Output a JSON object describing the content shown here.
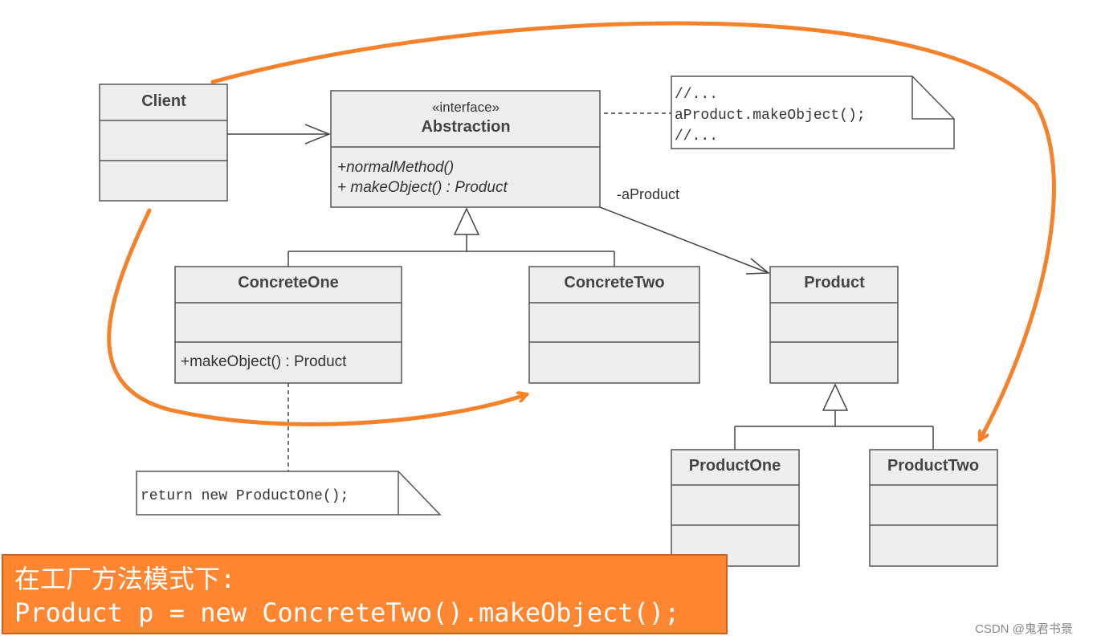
{
  "classes": {
    "client": {
      "name": "Client"
    },
    "abstraction": {
      "stereotype": "«interface»",
      "name": "Abstraction",
      "ops": [
        "+normalMethod()",
        "+ makeObject() : Product"
      ]
    },
    "concrete_one": {
      "name": "ConcreteOne",
      "ops": [
        "+makeObject() : Product"
      ]
    },
    "concrete_two": {
      "name": "ConcreteTwo"
    },
    "product": {
      "name": "Product"
    },
    "product_one": {
      "name": "ProductOne"
    },
    "product_two": {
      "name": "ProductTwo"
    }
  },
  "association_label": "-aProduct",
  "notes": {
    "abstraction_note": [
      "//...",
      "aProduct.makeObject();",
      "//..."
    ],
    "concrete_one_note": "return new ProductOne();"
  },
  "banner": {
    "line1": "在工厂方法模式下:",
    "line2": "Product p = new ConcreteTwo().makeObject();"
  },
  "watermark": "CSDN @鬼君书景",
  "colors": {
    "highlight": "#F5822A",
    "banner_bg": "#FF8630",
    "class_fill": "#eeeeee"
  }
}
